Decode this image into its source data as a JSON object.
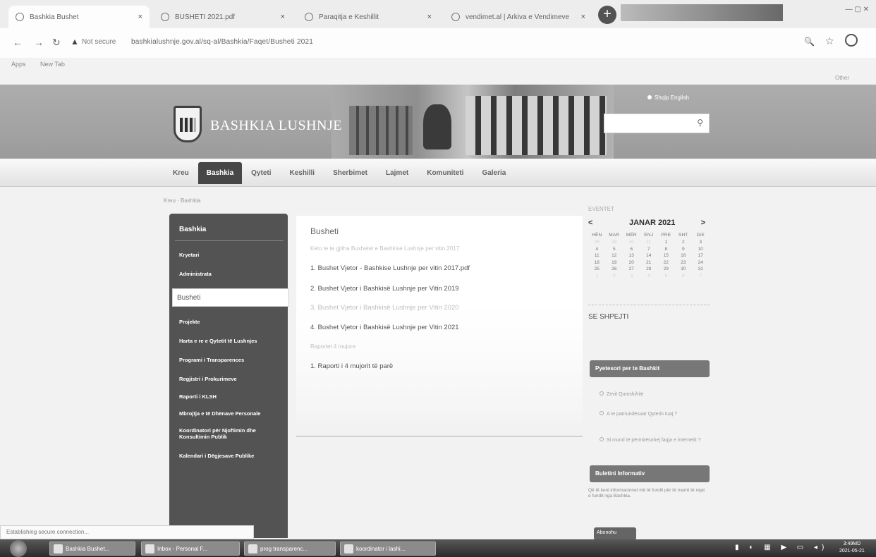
{
  "browser": {
    "tabs": [
      {
        "title": "Bashkia Bushet",
        "close": "×"
      },
      {
        "title": "BUSHETI 2021.pdf",
        "close": "×"
      },
      {
        "title": "Paraqitja e Keshillit",
        "close": "×"
      },
      {
        "title": "vendimet.al | Arkiva e Vendimeve",
        "close": "×"
      }
    ],
    "new_tab": "+",
    "window_controls": "— ▢ ✕",
    "back": "←",
    "forward": "→",
    "reload": "↻",
    "security_icon": "▲",
    "security_label": "Not secure",
    "url": "bashkialushnje.gov.al/sq-al/Bashkia/Faqet/Busheti 2021",
    "zoom": "🔍",
    "bookmark_star": "☆",
    "bookmarks": [
      "Apps",
      "New Tab"
    ],
    "other_bookmarks": "Other",
    "status": "Establishing secure connection..."
  },
  "header": {
    "site_name": "BASHKIA LUSHNJE",
    "lang_label": "Shqip  English",
    "search_placeholder": "",
    "search_icon": "⚲"
  },
  "nav": {
    "items": [
      "Kreu",
      "Bashkia",
      "Qyteti",
      "Keshilli",
      "Sherbimet",
      "Lajmet",
      "Komuniteti",
      "Galeria"
    ],
    "active": "Bashkia"
  },
  "breadcrumb": "Kreu  ·  Bashkia",
  "left_menu": {
    "title": "Bashkia",
    "items": [
      "Kryetari",
      "Administrata",
      "Busheti",
      "Projekte",
      "Harta e re e Qytetit të Lushnjes",
      "Programi i Transparences",
      "Regjistri i Prokurimeve",
      "Raporti i KLSH",
      "Mbrojtja e të Dhënave Personale",
      "Koordinatori për Njoftimin dhe Konsultimin Publik",
      "Kalendari i Dëgjesave Publike"
    ],
    "active": "Busheti"
  },
  "content": {
    "title": "Busheti",
    "subtitle": "Keto te te gjitha Buxhetet e Bashkise Lushnje per vitin 2017",
    "items": [
      "1. Bushet Vjetor - Bashkise Lushnje per vitin 2017.pdf",
      "2. Bushet Vjetor i Bashkisë Lushnje per Vitin 2019",
      "3. Bushet Vjetor i Bashkisë Lushnje per Vitin 2020",
      "4. Bushet Vjetor i Bashkisë Lushnje per Vitin 2021"
    ],
    "section": "Raportet 4 mujore",
    "report": "1. Raporti i 4 mujorit të parë"
  },
  "calendar": {
    "label": "EVENTET",
    "prev": "<",
    "month": "JANAR 2021",
    "next": ">",
    "days": [
      "HËN",
      "MAR",
      "MËR",
      "ENJ",
      "PRE",
      "SHT",
      "DIE"
    ],
    "weeks": [
      [
        "28",
        "29",
        "30",
        "31",
        "1",
        "2",
        "3"
      ],
      [
        "4",
        "5",
        "6",
        "7",
        "8",
        "9",
        "10"
      ],
      [
        "11",
        "12",
        "13",
        "14",
        "15",
        "16",
        "17"
      ],
      [
        "18",
        "19",
        "20",
        "21",
        "22",
        "23",
        "24"
      ],
      [
        "25",
        "26",
        "27",
        "28",
        "29",
        "30",
        "31"
      ],
      [
        "1",
        "2",
        "3",
        "4",
        "5",
        "6",
        "7"
      ]
    ],
    "faint_first_row_count": 4
  },
  "right": {
    "quick_label": "SE SHPEJTI",
    "poll_title": "Pyetesori per te Bashkit",
    "poll_options": [
      "Zevit Qumshi/rile",
      "A te pamundësuar Qytetin tuaj ?",
      "Si mund të përmirësohej faqja e internetit ?"
    ],
    "news_title": "Buletini Informativ",
    "news_text": "Që të keni informacionet më të fundit për të marrë të rejat e fundit nga Bashkia.",
    "subscribe": "Abonohu"
  },
  "taskbar": {
    "items": [
      "Bashkia Bushet...",
      "Inbox - Personal F...",
      "prog transparenc...",
      "koordinator i lashi..."
    ],
    "tray": "▮ ◐ ▦ ▶ ▭ ◂)",
    "time": "3:49MD",
    "date": "2021-05-21"
  }
}
